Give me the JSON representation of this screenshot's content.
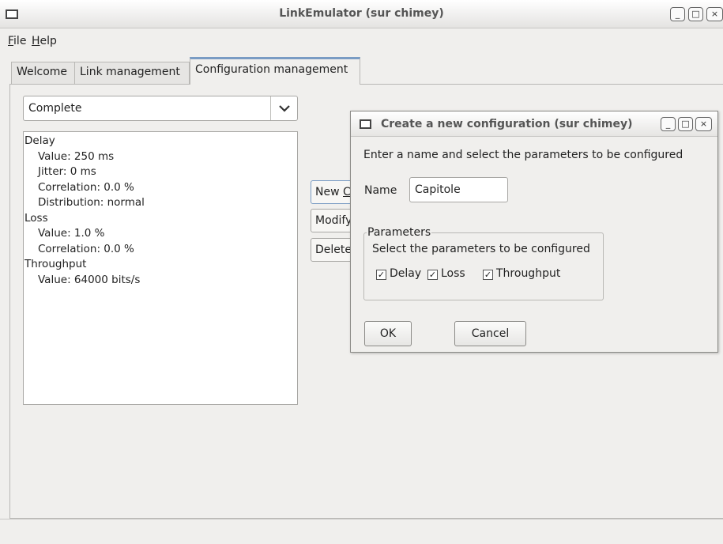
{
  "window": {
    "title": "LinkEmulator  (sur chimey)",
    "controls": {
      "minimize": "_",
      "maximize": "□",
      "close": "×"
    }
  },
  "menubar": {
    "file": {
      "mnemonic": "F",
      "rest": "ile"
    },
    "help": {
      "mnemonic": "H",
      "rest": "elp"
    }
  },
  "tabs": [
    {
      "label": "Welcome",
      "active": false
    },
    {
      "label": "Link management",
      "active": false
    },
    {
      "label": "Configuration management",
      "active": true
    }
  ],
  "config_select": {
    "value": "Complete",
    "arrow": "⌄"
  },
  "parameters_list": [
    {
      "text": "Delay",
      "level": 0
    },
    {
      "text": "Value: 250 ms",
      "level": 1
    },
    {
      "text": "Jitter: 0 ms",
      "level": 1
    },
    {
      "text": "Correlation: 0.0 %",
      "level": 1
    },
    {
      "text": "Distribution: normal",
      "level": 1
    },
    {
      "text": "Loss",
      "level": 0
    },
    {
      "text": "Value: 1.0 %",
      "level": 1
    },
    {
      "text": "Correlation: 0.0 %",
      "level": 1
    },
    {
      "text": "Throughput",
      "level": 0
    },
    {
      "text": "Value: 64000 bits/s",
      "level": 1
    }
  ],
  "side_buttons": {
    "new": {
      "prefix": "New ",
      "mnemonic": "C"
    },
    "modify": "Modify",
    "delete": "Delete"
  },
  "dialog": {
    "title": "Create a new configuration  (sur chimey)",
    "prompt": "Enter a name and select the parameters to be configured",
    "name_label": "Name",
    "name_value": "Capitole",
    "group_title": "Parameters",
    "group_description": "Select the parameters to be configured",
    "checkboxes": [
      {
        "label": "Delay",
        "checked": true
      },
      {
        "label": "Loss",
        "checked": true
      },
      {
        "label": "Throughput",
        "checked": true
      }
    ],
    "ok_label": "OK",
    "cancel_label": "Cancel",
    "check_glyph": "✓"
  }
}
